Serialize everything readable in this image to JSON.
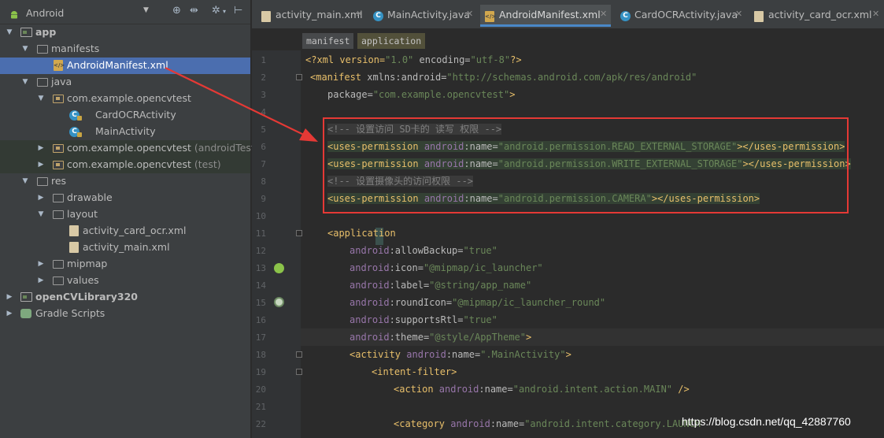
{
  "project_panel": {
    "view_name": "Android",
    "tree": [
      {
        "label": "app",
        "suffix": ""
      },
      {
        "label": "manifests",
        "suffix": ""
      },
      {
        "label": "AndroidManifest.xml",
        "suffix": ""
      },
      {
        "label": "java",
        "suffix": ""
      },
      {
        "label": "com.example.opencvtest",
        "suffix": ""
      },
      {
        "label": "CardOCRActivity",
        "suffix": ""
      },
      {
        "label": "MainActivity",
        "suffix": ""
      },
      {
        "label": "com.example.opencvtest",
        "suffix": "(androidTest)"
      },
      {
        "label": "com.example.opencvtest",
        "suffix": "(test)"
      },
      {
        "label": "res",
        "suffix": ""
      },
      {
        "label": "drawable",
        "suffix": ""
      },
      {
        "label": "layout",
        "suffix": ""
      },
      {
        "label": "activity_card_ocr.xml",
        "suffix": ""
      },
      {
        "label": "activity_main.xml",
        "suffix": ""
      },
      {
        "label": "mipmap",
        "suffix": ""
      },
      {
        "label": "values",
        "suffix": ""
      },
      {
        "label": "openCVLibrary320",
        "suffix": ""
      },
      {
        "label": "Gradle Scripts",
        "suffix": ""
      }
    ]
  },
  "tabs": [
    {
      "label": "activity_main.xml",
      "icon": "xml-file-icon"
    },
    {
      "label": "MainActivity.java",
      "icon": "class-icon"
    },
    {
      "label": "AndroidManifest.xml",
      "icon": "xml-file-icon",
      "active": true
    },
    {
      "label": "CardOCRActivity.java",
      "icon": "class-icon"
    },
    {
      "label": "activity_card_ocr.xml",
      "icon": "xml-file-icon"
    }
  ],
  "breadcrumb": {
    "manifest": "manifest",
    "application": "application"
  },
  "code": {
    "line_numbers": [
      "1",
      "2",
      "3",
      "4",
      "5",
      "6",
      "7",
      "8",
      "9",
      "10",
      "11",
      "12",
      "13",
      "14",
      "15",
      "16",
      "17",
      "18",
      "19",
      "20",
      "21",
      "22"
    ],
    "l1": {
      "pre": "<?xml version=",
      "version": "\"1.0\"",
      "mid": " encoding=",
      "encoding": "\"utf-8\"",
      "end": "?>"
    },
    "l2": {
      "open": "<manifest",
      "ns": " xmlns:android",
      "eq": "=",
      "val": "\"http://schemas.android.com/apk/res/android\""
    },
    "l3": {
      "attr": "package",
      "eq": "=",
      "val": "\"com.example.opencvtest\"",
      "close": ">"
    },
    "l5": "<!-- 设置访问 SD卡的 读写 权限 -->",
    "l6": {
      "open": "<uses-permission",
      "ns": "android",
      "attr": ":name",
      "eq": "=",
      "val": "\"android.permission.READ_EXTERNAL_STORAGE\"",
      "close": "></uses-permission>"
    },
    "l7": {
      "open": "<uses-permission",
      "ns": "android",
      "attr": ":name",
      "eq": "=",
      "val": "\"android.permission.WRITE_EXTERNAL_STORAGE\"",
      "close": "></uses-permission>"
    },
    "l8": "<!-- 设置摄像头的访问权限 -->",
    "l9": {
      "open": "<uses-permission",
      "ns": "android",
      "attr": ":name",
      "eq": "=",
      "val": "\"android.permission.CAMERA\"",
      "close": "></uses-permission>"
    },
    "l11": "<application",
    "l12": {
      "ns": "android",
      "attr": ":allowBackup",
      "eq": "=",
      "val": "\"true\""
    },
    "l13": {
      "ns": "android",
      "attr": ":icon",
      "eq": "=",
      "val": "\"@mipmap/ic_launcher\""
    },
    "l14": {
      "ns": "android",
      "attr": ":label",
      "eq": "=",
      "val": "\"@string/app_name\""
    },
    "l15": {
      "ns": "android",
      "attr": ":roundIcon",
      "eq": "=",
      "val": "\"@mipmap/ic_launcher_round\""
    },
    "l16": {
      "ns": "android",
      "attr": ":supportsRtl",
      "eq": "=",
      "val": "\"true\""
    },
    "l17": {
      "ns": "android",
      "attr": ":theme",
      "eq": "=",
      "val": "\"@style/AppTheme\"",
      "close": ">"
    },
    "l18": {
      "open": "<activity",
      "ns": " android",
      "attr": ":name",
      "eq": "=",
      "val": "\".MainActivity\"",
      "close": ">"
    },
    "l19": "<intent-filter>",
    "l20": {
      "open": "<action",
      "ns": " android",
      "attr": ":name",
      "eq": "=",
      "val": "\"android.intent.action.MAIN\"",
      "close": " />"
    },
    "l22": {
      "open": "<category",
      "ns": " android",
      "attr": ":name",
      "eq": "=",
      "val": "\"android.intent.category.LAUNCH"
    }
  },
  "watermark": "https://blog.csdn.net/qq_42887760",
  "colors": {
    "annotation_red": "#e53935",
    "selection": "#4b6eaf",
    "accent_tab": "#4a88c7"
  }
}
